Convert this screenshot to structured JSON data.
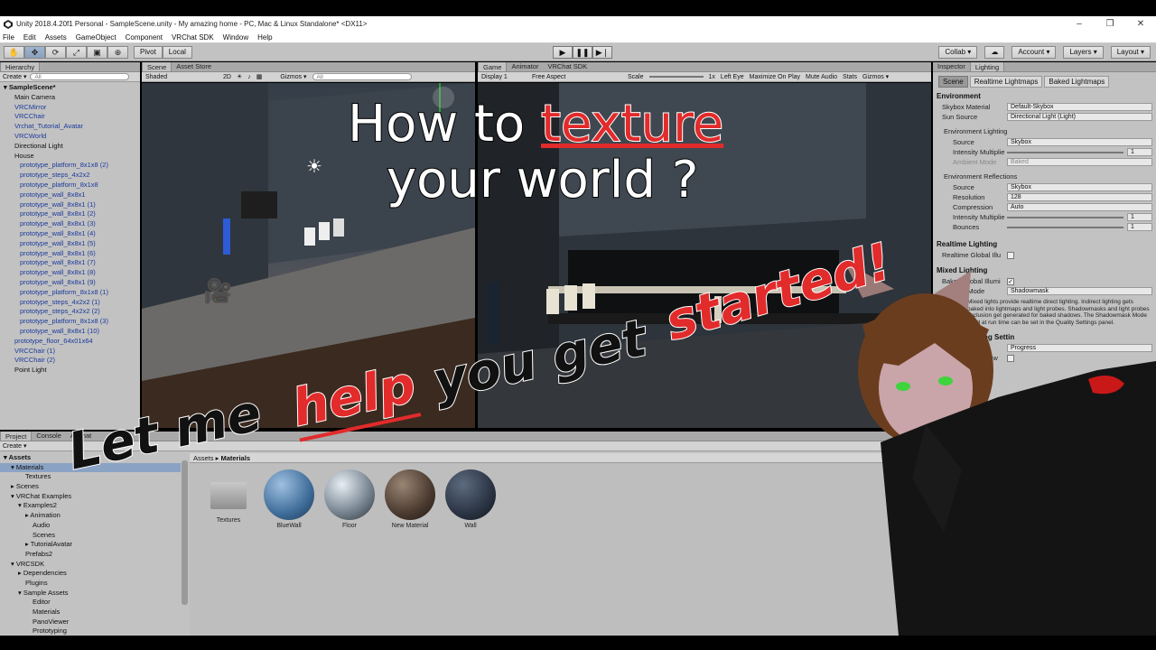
{
  "window": {
    "title": "Unity 2018.4.20f1 Personal - SampleScene.unity - My amazing home - PC, Mac & Linux Standalone* <DX11>",
    "controls": [
      "–",
      "❐",
      "✕"
    ]
  },
  "menu": [
    "File",
    "Edit",
    "Assets",
    "GameObject",
    "Component",
    "VRChat SDK",
    "Window",
    "Help"
  ],
  "toolbar": {
    "tools": [
      "hand-icon",
      "move-icon",
      "rotate-icon",
      "scale-icon",
      "rect-icon",
      "transform-icon"
    ],
    "pivot": "Pivot",
    "local": "Local",
    "collab": "Collab ▾",
    "account": "Account ▾",
    "layers": "Layers ▾",
    "layout": "Layout ▾"
  },
  "hierarchy": {
    "tab": "Hierarchy",
    "create": "Create ▾",
    "search": "All",
    "items": [
      {
        "label": "▾ SampleScene*",
        "style": "bold",
        "indent": 0
      },
      {
        "label": "Main Camera",
        "style": "plain",
        "indent": 2
      },
      {
        "label": "VRCMirror",
        "style": "blue",
        "indent": 2
      },
      {
        "label": "VRCChair",
        "style": "blue",
        "indent": 2
      },
      {
        "label": "Vrchat_Tutorial_Avatar",
        "style": "blue",
        "indent": 2
      },
      {
        "label": "VRCWorld",
        "style": "blue",
        "indent": 2
      },
      {
        "label": "Directional Light",
        "style": "plain",
        "indent": 2
      },
      {
        "label": "House",
        "style": "plain",
        "indent": 2
      },
      {
        "label": "prototype_platform_8x1x8 (2)",
        "style": "blue",
        "indent": 3
      },
      {
        "label": "prototype_steps_4x2x2",
        "style": "blue",
        "indent": 3
      },
      {
        "label": "prototype_platform_8x1x8",
        "style": "blue",
        "indent": 3
      },
      {
        "label": "prototype_wall_8x8x1",
        "style": "blue",
        "indent": 3
      },
      {
        "label": "prototype_wall_8x8x1 (1)",
        "style": "blue",
        "indent": 3
      },
      {
        "label": "prototype_wall_8x8x1 (2)",
        "style": "blue",
        "indent": 3
      },
      {
        "label": "prototype_wall_8x8x1 (3)",
        "style": "blue",
        "indent": 3
      },
      {
        "label": "prototype_wall_8x8x1 (4)",
        "style": "blue",
        "indent": 3
      },
      {
        "label": "prototype_wall_8x8x1 (5)",
        "style": "blue",
        "indent": 3
      },
      {
        "label": "prototype_wall_8x8x1 (6)",
        "style": "blue",
        "indent": 3
      },
      {
        "label": "prototype_wall_8x8x1 (7)",
        "style": "blue",
        "indent": 3
      },
      {
        "label": "prototype_wall_8x8x1 (8)",
        "style": "blue",
        "indent": 3
      },
      {
        "label": "prototype_wall_8x8x1 (9)",
        "style": "blue",
        "indent": 3
      },
      {
        "label": "prototype_platform_8x1x8 (1)",
        "style": "blue",
        "indent": 3
      },
      {
        "label": "prototype_steps_4x2x2 (1)",
        "style": "blue",
        "indent": 3
      },
      {
        "label": "prototype_steps_4x2x2 (2)",
        "style": "blue",
        "indent": 3
      },
      {
        "label": "prototype_platform_8x1x8 (3)",
        "style": "blue",
        "indent": 3
      },
      {
        "label": "prototype_wall_8x8x1 (10)",
        "style": "blue",
        "indent": 3
      },
      {
        "label": "prototype_floor_64x01x64",
        "style": "blue",
        "indent": 2
      },
      {
        "label": "VRCChair (1)",
        "style": "blue",
        "indent": 2
      },
      {
        "label": "VRCChair (2)",
        "style": "blue",
        "indent": 2
      },
      {
        "label": "Point Light",
        "style": "plain",
        "indent": 2
      }
    ]
  },
  "scene": {
    "tabs": [
      "Scene",
      "Asset Store"
    ],
    "shading": "Shaded",
    "mode2d": "2D",
    "gizmos": "Gizmos ▾",
    "search": "All"
  },
  "game": {
    "tabs": [
      "Game",
      "Animator",
      "VRChat SDK"
    ],
    "display": "Display 1",
    "aspect": "Free Aspect",
    "scale_label": "Scale",
    "scale_value": "1x",
    "eye": "Left Eye",
    "options": [
      "Maximize On Play",
      "Mute Audio",
      "Stats",
      "Gizmos ▾"
    ]
  },
  "inspector": {
    "tabs": [
      "Inspector",
      "Lighting"
    ],
    "subtabs": [
      "Scene",
      "Realtime Lightmaps",
      "Baked Lightmaps"
    ],
    "environment": "Environment",
    "skybox_label": "Skybox Material",
    "skybox_value": "Default-Skybox",
    "sun_label": "Sun Source",
    "sun_value": "Directional Light (Light)",
    "env_lighting": "Environment Lighting",
    "source_label": "Source",
    "source_value": "Skybox",
    "intensity_label": "Intensity Multiplie",
    "intensity_value": "1",
    "ambient_label": "Ambient Mode",
    "ambient_value": "Baked",
    "env_reflections": "Environment Reflections",
    "refl_source_label": "Source",
    "refl_source_value": "Skybox",
    "resolution_label": "Resolution",
    "resolution_value": "128",
    "compression_label": "Compression",
    "compression_value": "Auto",
    "refl_intensity_label": "Intensity Multiplie",
    "refl_intensity_value": "1",
    "bounces_label": "Bounces",
    "bounces_value": "1",
    "realtime": "Realtime Lighting",
    "realtime_gi": "Realtime Global Illu",
    "mixed": "Mixed Lighting",
    "baked_gi": "Baked Global Illumi",
    "lighting_mode_label": "Lighting Mode",
    "lighting_mode_value": "Shadowmask",
    "mixed_info": "Mixed lights provide realtime direct lighting. Indirect lighting gets baked into lightmaps and light probes. Shadowmasks and light probes occlusion get generated for baked shadows. The Shadowmask Mode used at run time can be set in the Quality Settings panel.",
    "mapping": "pping Settin",
    "lightmapper": "per",
    "lightmapper_value": "Progress",
    "prioritize": "ize View",
    "samples": "ples",
    "per_unit_1": "per unit",
    "per_unit_2": "per unit",
    "texels": "texels",
    "num_a": "1",
    "num_b": "0",
    "num_c": "1",
    "foot_1": "0",
    "foot_2": "Occ",
    "foot_3": "Tota"
  },
  "project": {
    "tabs": [
      "Project",
      "Console",
      "Animat"
    ],
    "create": "Create ▾",
    "breadcrumb_root": "Assets",
    "breadcrumb_sep": "▸",
    "breadcrumb_leaf": "Materials",
    "tree": [
      {
        "label": "▾ Assets",
        "bold": true,
        "indent": 0
      },
      {
        "label": "▾ Materials",
        "bold": false,
        "indent": 1,
        "sel": true
      },
      {
        "label": "Textures",
        "bold": false,
        "indent": 3
      },
      {
        "label": "▸ Scenes",
        "bold": false,
        "indent": 1
      },
      {
        "label": "▾ VRChat Examples",
        "bold": false,
        "indent": 1
      },
      {
        "label": "▾ Examples2",
        "bold": false,
        "indent": 2
      },
      {
        "label": "▸ Animation",
        "bold": false,
        "indent": 3
      },
      {
        "label": "Audio",
        "bold": false,
        "indent": 4
      },
      {
        "label": "Scenes",
        "bold": false,
        "indent": 4
      },
      {
        "label": "▸ TutorialAvatar",
        "bold": false,
        "indent": 3
      },
      {
        "label": "Prefabs2",
        "bold": false,
        "indent": 3
      },
      {
        "label": "▾ VRCSDK",
        "bold": false,
        "indent": 1
      },
      {
        "label": "▸ Dependencies",
        "bold": false,
        "indent": 2
      },
      {
        "label": "Plugins",
        "bold": false,
        "indent": 3
      },
      {
        "label": "▾ Sample Assets",
        "bold": false,
        "indent": 2
      },
      {
        "label": "Editor",
        "bold": false,
        "indent": 4
      },
      {
        "label": "Materials",
        "bold": false,
        "indent": 4
      },
      {
        "label": "PanoViewer",
        "bold": false,
        "indent": 4
      },
      {
        "label": "Prototyping",
        "bold": false,
        "indent": 4
      }
    ],
    "assets": [
      {
        "label": "Textures",
        "kind": "folder"
      },
      {
        "label": "BlueWall",
        "kind": "blue"
      },
      {
        "label": "Floor",
        "kind": "floor"
      },
      {
        "label": "New Material",
        "kind": "brown"
      },
      {
        "label": "Wall",
        "kind": "dark"
      }
    ]
  },
  "overlay": {
    "line1_a": "How to ",
    "line1_b": "texture",
    "line2": "your world ?",
    "let_me": "Let me",
    "help": "help",
    "you_get": "you get",
    "started": "started!"
  },
  "colors": {
    "accent_red": "#e22b2b",
    "selection": "#8aa2c4",
    "prefab_blue": "#1b3a9a",
    "panel_gray": "#c2c2c2"
  }
}
